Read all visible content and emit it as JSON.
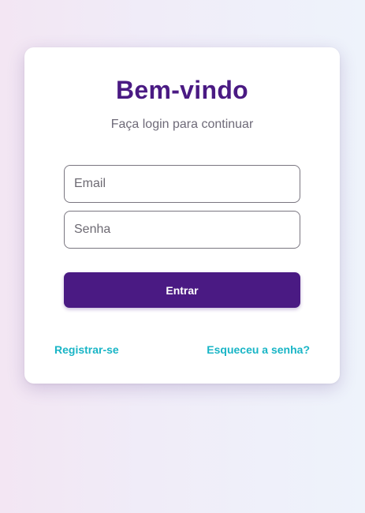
{
  "login": {
    "title": "Bem-vindo",
    "subtitle": "Faça login para continuar",
    "email_placeholder": "Email",
    "email_value": "",
    "password_placeholder": "Senha",
    "password_value": "",
    "submit_label": "Entrar",
    "register_link": "Registrar-se",
    "forgot_link": "Esqueceu a senha?"
  },
  "colors": {
    "primary": "#4a1a83",
    "link": "#19b5c6",
    "subtitle": "#6e6a78",
    "card_background": "#ffffff"
  }
}
